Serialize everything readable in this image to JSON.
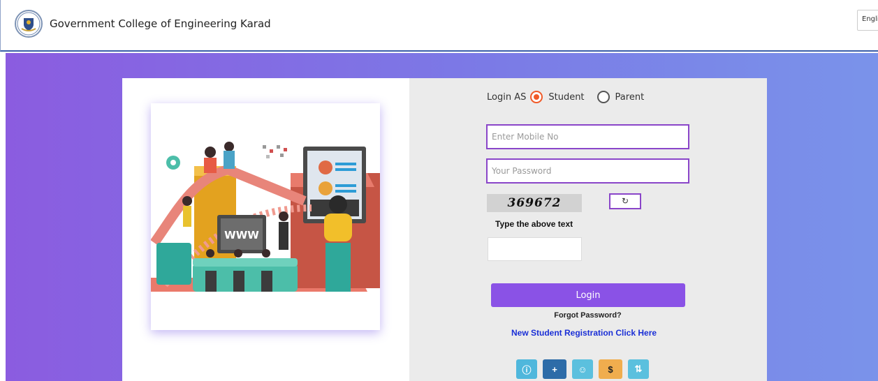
{
  "header": {
    "title": "Government College of Engineering Karad",
    "language": "English"
  },
  "login": {
    "login_as_label": "Login AS",
    "roles": [
      {
        "label": "Student",
        "selected": true
      },
      {
        "label": "Parent",
        "selected": false
      }
    ],
    "mobile_placeholder": "Enter Mobile No",
    "password_placeholder": "Your Password",
    "captcha_text": "369672",
    "refresh_icon": "refresh-icon",
    "type_above_label": "Type the above text",
    "login_button": "Login",
    "forgot_password": "Forgot Password?",
    "new_registration": "New Student Registration Click Here"
  },
  "action_icons": [
    {
      "icon": "info-icon",
      "color": "#4fb7dc"
    },
    {
      "icon": "plus-icon",
      "color": "#2d6ca8"
    },
    {
      "icon": "user-icon",
      "color": "#5bc0de"
    },
    {
      "icon": "dollar-icon",
      "color": "#f0ad4e"
    },
    {
      "icon": "sort-icon",
      "color": "#5bc0de"
    }
  ],
  "colors": {
    "accent": "#8a52e6",
    "field_border": "#8a45c9",
    "radio_selected": "#f05a28",
    "link": "#1a2fd6"
  },
  "illustration_text": "WWW"
}
